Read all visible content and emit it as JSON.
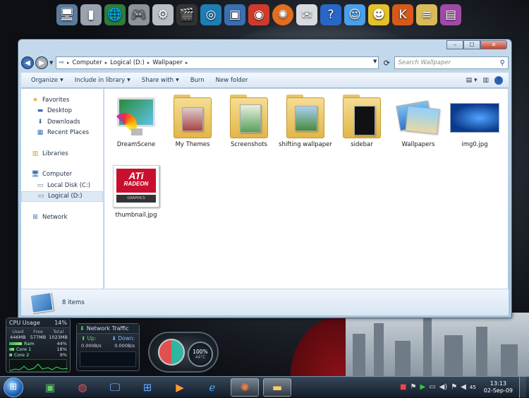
{
  "window": {
    "controls": {
      "minimize": "–",
      "maximize": "☐",
      "close": "✕"
    },
    "breadcrumb": [
      "Computer",
      "Logical (D:)",
      "Wallpaper"
    ],
    "search_placeholder": "Search Wallpaper"
  },
  "toolbar": {
    "organize": "Organize",
    "include_in_library": "Include in library",
    "share_with": "Share with",
    "burn": "Burn",
    "new_folder": "New folder"
  },
  "nav_pane": {
    "favorites": "Favorites",
    "desktop": "Desktop",
    "downloads": "Downloads",
    "recent_places": "Recent Places",
    "libraries": "Libraries",
    "computer": "Computer",
    "local_disk": "Local Disk (C:)",
    "logical": "Logical (D:)",
    "network": "Network"
  },
  "files": [
    {
      "name": "DreamScene",
      "icon": "dreamscene-icon"
    },
    {
      "name": "My Themes",
      "icon": "folder-icon"
    },
    {
      "name": "Screenshots",
      "icon": "folder-icon"
    },
    {
      "name": "shifting wallpaper",
      "icon": "folder-icon"
    },
    {
      "name": "sidebar",
      "icon": "folder-icon"
    },
    {
      "name": "Wallpapers",
      "icon": "photos-icon"
    },
    {
      "name": "img0.jpg",
      "icon": "image-thumbnail"
    },
    {
      "name": "thumbnail.jpg",
      "icon": "ati-radeon-thumbnail"
    }
  ],
  "ati_logo": {
    "brand": "ATi",
    "line": "RADEON",
    "sub": "GRAPHICS"
  },
  "status": {
    "items": "8 items"
  },
  "cpu_gadget": {
    "title": "CPU Usage",
    "percent": "14%",
    "headers": [
      "Used",
      "Free",
      "Total"
    ],
    "values": [
      "446MB",
      "577MB",
      "1023MB"
    ],
    "ram": {
      "label": "Ram",
      "value": "44%",
      "level": 0.44
    },
    "core1": {
      "label": "Core 1",
      "value": "18%",
      "level": 0.18
    },
    "core2": {
      "label": "Core 2",
      "value": "9%",
      "level": 0.09
    }
  },
  "net_gadget": {
    "title": "Network Traffic",
    "up_label": "Up:",
    "down_label": "Down:",
    "up_value": "0.000B/s",
    "down_value": "0.000B/s"
  },
  "gauge_gadget": {
    "percent": "100%",
    "sub": "44°C"
  },
  "tray": {
    "volume": "45",
    "time": "13:13",
    "date": "02-Sep-09"
  },
  "colors": {
    "accent": "#1d4f96",
    "folder": "#e2b649",
    "selection": "#dde9f5"
  }
}
